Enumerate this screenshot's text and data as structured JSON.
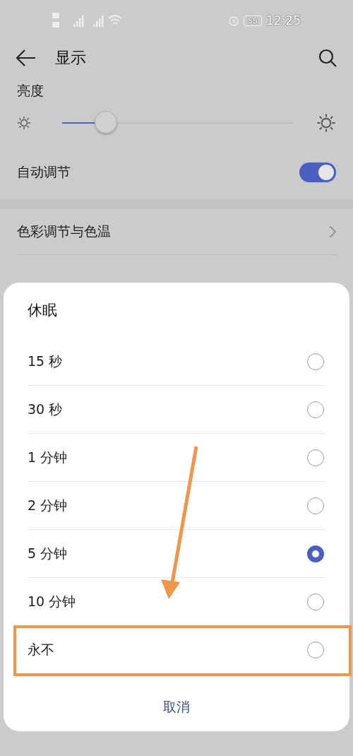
{
  "status_bar": {
    "battery": "55",
    "time": "12:25"
  },
  "header": {
    "title": "显示"
  },
  "brightness": {
    "label": "亮度",
    "level": 0.19
  },
  "auto_adjust": {
    "label": "自动调节",
    "on": true
  },
  "settings": [
    {
      "label": "色彩调节与色温"
    }
  ],
  "dialog": {
    "title": "休眠",
    "options": [
      {
        "label": "15 秒",
        "selected": false,
        "highlighted": false
      },
      {
        "label": "30 秒",
        "selected": false,
        "highlighted": false
      },
      {
        "label": "1 分钟",
        "selected": false,
        "highlighted": false
      },
      {
        "label": "2 分钟",
        "selected": false,
        "highlighted": false
      },
      {
        "label": "5 分钟",
        "selected": true,
        "highlighted": false
      },
      {
        "label": "10 分钟",
        "selected": false,
        "highlighted": false
      },
      {
        "label": "永不",
        "selected": false,
        "highlighted": true
      }
    ],
    "cancel": "取消"
  }
}
